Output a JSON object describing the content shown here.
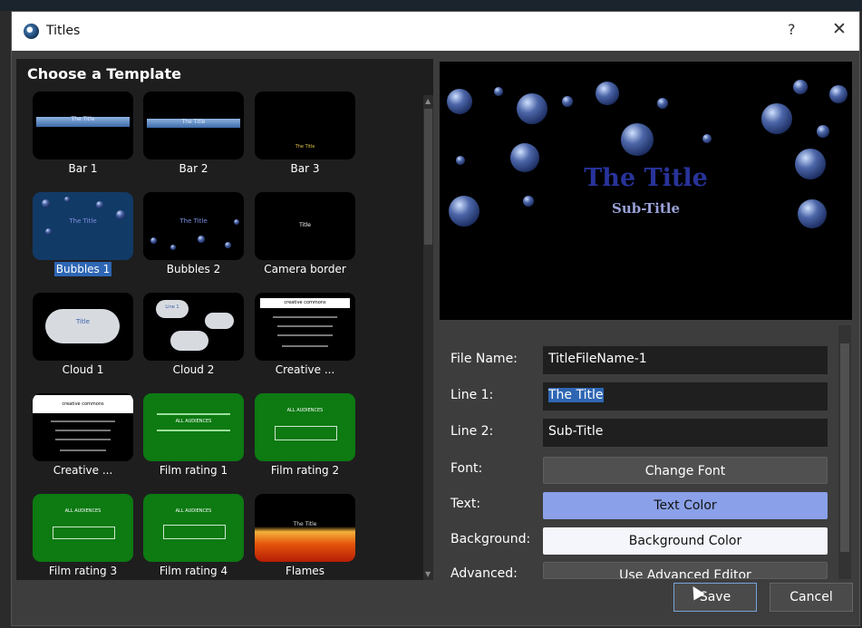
{
  "window": {
    "title": "Titles",
    "help_label": "?",
    "close_label": "✕"
  },
  "templates": {
    "heading": "Choose a Template",
    "items": [
      {
        "label": "Bar 1",
        "thumb_text": "The Title"
      },
      {
        "label": "Bar 2",
        "thumb_text": "The Title"
      },
      {
        "label": "Bar 3",
        "thumb_text": "The Title"
      },
      {
        "label": "Bubbles 1",
        "thumb_text": "The Title"
      },
      {
        "label": "Bubbles 2",
        "thumb_text": "The Title"
      },
      {
        "label": "Camera border",
        "thumb_text": "Title"
      },
      {
        "label": "Cloud 1",
        "thumb_text": "Title"
      },
      {
        "label": "Cloud 2",
        "thumb_text": "Line 1"
      },
      {
        "label": "Creative ...",
        "thumb_text": "creative commons"
      },
      {
        "label": "Creative ...",
        "thumb_text": "creative commons"
      },
      {
        "label": "Film rating 1",
        "thumb_text": "ALL AUDIENCES"
      },
      {
        "label": "Film rating 2",
        "thumb_text": "ALL AUDIENCES"
      },
      {
        "label": "Film rating 3",
        "thumb_text": "ALL AUDIENCES"
      },
      {
        "label": "Film rating 4",
        "thumb_text": "ALL AUDIENCES"
      },
      {
        "label": "Flames",
        "thumb_text": "The Title"
      }
    ],
    "selected_index": 3
  },
  "preview": {
    "title": "The Title",
    "subtitle": "Sub-Title"
  },
  "form": {
    "file_name_label": "File Name:",
    "file_name_value": "TitleFileName-1",
    "line1_label": "Line 1:",
    "line1_value": "The Title",
    "line2_label": "Line 2:",
    "line2_value": "Sub-Title",
    "font_label": "Font:",
    "font_button": "Change Font",
    "text_label": "Text:",
    "text_button": "Text Color",
    "background_label": "Background:",
    "background_button": "Background Color",
    "advanced_label": "Advanced:",
    "advanced_button": "Use Advanced Editor"
  },
  "footer": {
    "save": "Save",
    "cancel": "Cancel"
  },
  "colors": {
    "selection": "#2e66b4",
    "text_color_button": "#8aa0e8",
    "background_button": "#f4f6fb",
    "preview_title": "#28339a"
  }
}
